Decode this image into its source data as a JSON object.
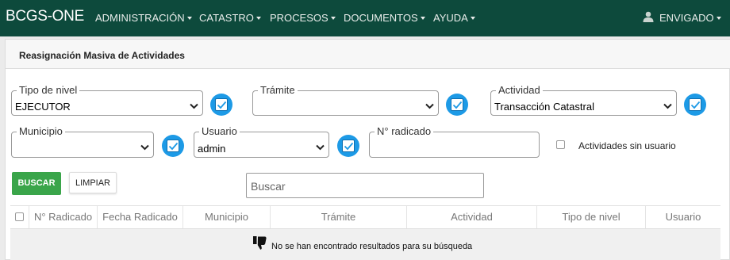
{
  "navbar": {
    "brand": "BCGS-ONE",
    "menu": [
      {
        "label": "ADMINISTRACIÓN"
      },
      {
        "label": "CATASTRO"
      },
      {
        "label": "PROCESOS"
      },
      {
        "label": "DOCUMENTOS"
      },
      {
        "label": "AYUDA"
      }
    ],
    "user": "ENVIGADO"
  },
  "panel": {
    "title": "Reasignación Masiva de Actividades"
  },
  "filters": {
    "tipo_nivel": {
      "label": "Tipo de nivel",
      "value": "EJECUTOR"
    },
    "tramite": {
      "label": "Trámite",
      "value": ""
    },
    "actividad": {
      "label": "Actividad",
      "value": "Transacción Catastral"
    },
    "municipio": {
      "label": "Municipio",
      "value": ""
    },
    "usuario": {
      "label": "Usuario",
      "value": "admin"
    },
    "radicado": {
      "label": "N° radicado",
      "value": ""
    },
    "sin_usuario": {
      "label": "Actividades sin usuario"
    }
  },
  "actions": {
    "buscar": "BUSCAR",
    "limpiar": "LIMPIAR",
    "search_placeholder": "Buscar"
  },
  "table": {
    "columns": [
      "N° Radicado",
      "Fecha Radicado",
      "Municipio",
      "Trámite",
      "Actividad",
      "Tipo de nivel",
      "Usuario"
    ],
    "empty_message": "No se han encontrado resultados para su búsqueda"
  },
  "colors": {
    "navbar": "#0d4a3c",
    "accent": "#1d9ae6",
    "buscar": "#3aa54a"
  },
  "icons": {
    "user": "user-icon",
    "check": "check-icon",
    "thumbs_down": "thumbs-down-icon"
  }
}
